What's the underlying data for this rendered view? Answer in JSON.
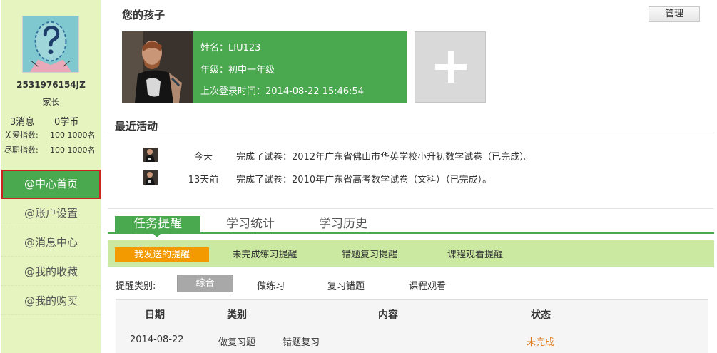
{
  "sidebar": {
    "user_id": "2531976154JZ",
    "role": "家长",
    "messages": "3消息",
    "coins": "0学币",
    "care_index_label": "关爱指数:",
    "care_index_value": "100 1000名",
    "duty_index_label": "尽职指数:",
    "duty_index_value": "100 1000名",
    "nav": [
      {
        "label": "@中心首页",
        "active": true
      },
      {
        "label": "@账户设置"
      },
      {
        "label": "@消息中心"
      },
      {
        "label": "@我的收藏"
      },
      {
        "label": "@我的购买"
      }
    ]
  },
  "children": {
    "title": "您的孩子",
    "manage_label": "管理",
    "child": {
      "name": "姓名：LIU123",
      "grade": "年级：初中一年级",
      "last_login": "上次登录时间：2014-08-22 15:46:54"
    }
  },
  "activity": {
    "title": "最近活动",
    "items": [
      {
        "time": "今天",
        "desc": "完成了试卷：2012年广东省佛山市华英学校小升初数学试卷（已完成）。"
      },
      {
        "time": "13天前",
        "desc": "完成了试卷：2010年广东省高考数学试卷（文科）（已完成）。"
      }
    ]
  },
  "tabs": [
    "任务提醒",
    "学习统计",
    "学习历史"
  ],
  "subtabs": [
    "我发送的提醒",
    "未完成练习提醒",
    "错题复习提醒",
    "课程观看提醒"
  ],
  "filter": {
    "label": "提醒类别:",
    "options": [
      "综合",
      "做练习",
      "复习错题",
      "课程观看"
    ]
  },
  "table": {
    "headers": [
      "日期",
      "类别",
      "内容",
      "状态"
    ],
    "rows": [
      {
        "date": "2014-08-22",
        "type": "做复习题",
        "content": "错题复习",
        "status": "未完成"
      }
    ]
  },
  "colors": {
    "accent": "#4aa84f",
    "sidebar_bg": "#e6f5c0",
    "active_border": "#c9241f",
    "orange": "#f39a00",
    "status_incomplete": "#e07a1a"
  }
}
